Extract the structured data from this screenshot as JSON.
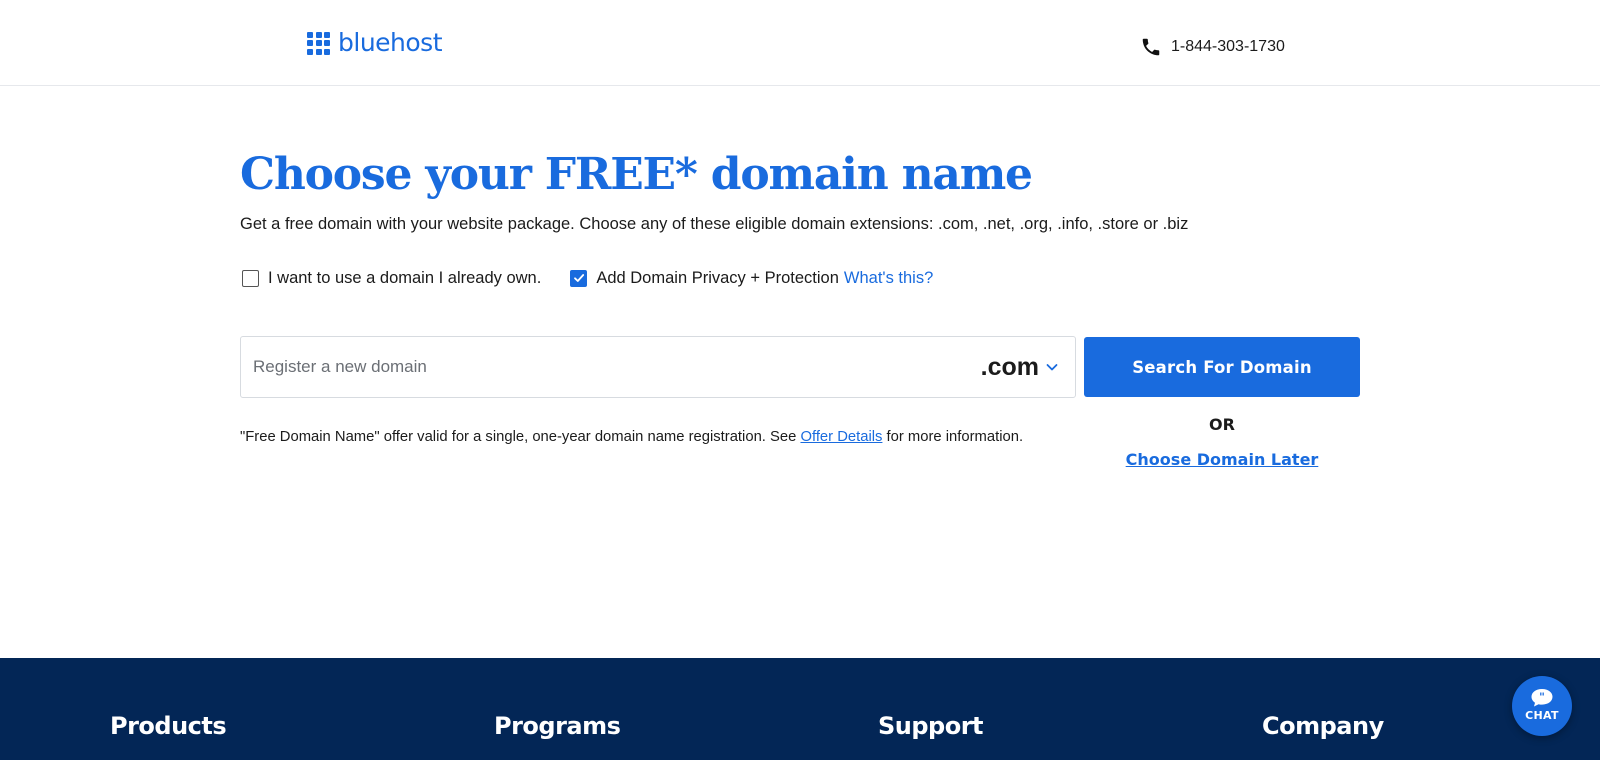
{
  "header": {
    "logo_text": "bluehost",
    "phone_number": "1-844-303-1730"
  },
  "hero": {
    "title": "Choose your FREE* domain name",
    "subtitle": "Get a free domain with your website package. Choose any of these eligible domain extensions: .com, .net, .org, .info, .store or .biz"
  },
  "options": {
    "own_domain_label": "I want to use a domain I already own.",
    "own_domain_checked": false,
    "privacy_label": "Add Domain Privacy + Protection",
    "privacy_checked": true,
    "whats_this": "What's this?"
  },
  "search": {
    "placeholder": "Register a new domain",
    "value": "",
    "tld": ".com",
    "button_label": "Search For Domain"
  },
  "disclaimer": {
    "before": "\"Free Domain Name\" offer valid for a single, one-year domain name registration. See ",
    "link": "Offer Details",
    "after": " for more information."
  },
  "alt_action": {
    "or_label": "OR",
    "choose_later": "Choose Domain Later"
  },
  "footer": {
    "columns": [
      "Products",
      "Programs",
      "Support",
      "Company"
    ]
  },
  "chat": {
    "label": "CHAT"
  },
  "colors": {
    "brand_blue": "#196bde",
    "footer_navy": "#032656"
  }
}
